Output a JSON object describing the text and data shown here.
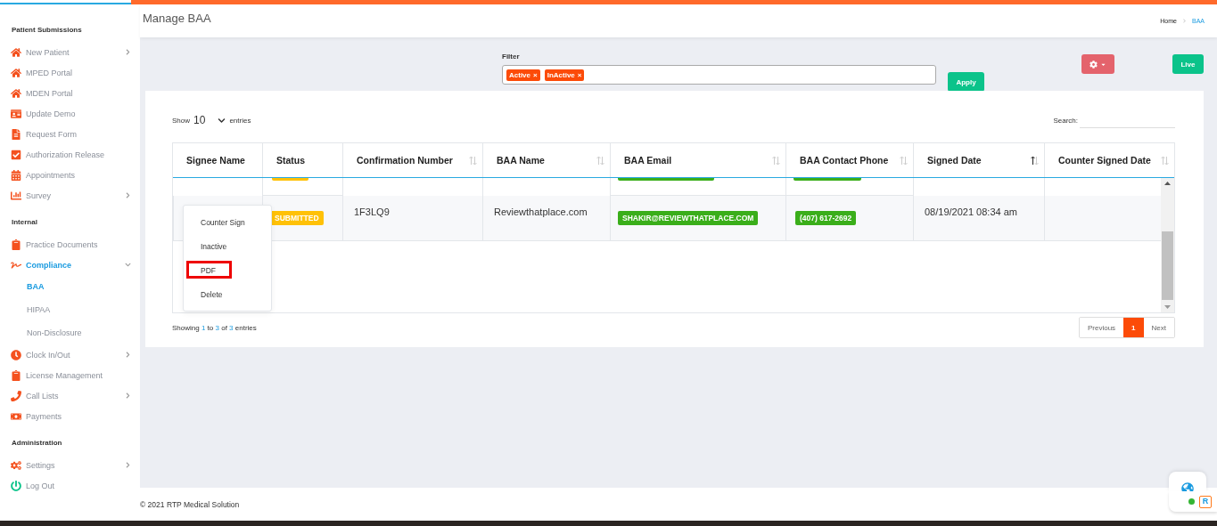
{
  "sidebar": {
    "sections": [
      {
        "title": "Patient Submissions",
        "items": [
          {
            "label": "New Patient",
            "kind": "home",
            "has_submenu": true,
            "expanded": false,
            "selected": false
          },
          {
            "label": "MPED Portal",
            "kind": "home",
            "has_submenu": false,
            "selected": false
          },
          {
            "label": "MDEN Portal",
            "kind": "home",
            "has_submenu": false,
            "selected": false
          },
          {
            "label": "Update Demo",
            "kind": "idcard",
            "has_submenu": false,
            "selected": false
          },
          {
            "label": "Request Form",
            "kind": "file",
            "has_submenu": false,
            "selected": false
          },
          {
            "label": "Authorization Release",
            "kind": "check",
            "has_submenu": false,
            "selected": false
          },
          {
            "label": "Appointments",
            "kind": "calendar",
            "has_submenu": false,
            "selected": false
          },
          {
            "label": "Survey",
            "kind": "chart",
            "has_submenu": true,
            "expanded": false,
            "selected": false
          }
        ]
      },
      {
        "title": "Internal",
        "items": [
          {
            "label": "Practice Documents",
            "kind": "clipboard",
            "has_submenu": false,
            "selected": false
          },
          {
            "label": "Compliance",
            "kind": "signature",
            "has_submenu": true,
            "expanded": true,
            "selected": true,
            "children": [
              {
                "label": "BAA",
                "selected": true
              },
              {
                "label": "HIPAA",
                "selected": false
              },
              {
                "label": "Non-Disclosure",
                "selected": false
              }
            ]
          },
          {
            "label": "Clock In/Out",
            "kind": "clock",
            "has_submenu": true,
            "expanded": false,
            "selected": false
          },
          {
            "label": "License Management",
            "kind": "clipboard",
            "has_submenu": false,
            "selected": false
          },
          {
            "label": "Call Lists",
            "kind": "phone",
            "has_submenu": true,
            "expanded": false,
            "selected": false
          },
          {
            "label": "Payments",
            "kind": "money",
            "has_submenu": false,
            "selected": false
          }
        ]
      },
      {
        "title": "Administration",
        "items": [
          {
            "label": "Settings",
            "kind": "gears",
            "has_submenu": true,
            "expanded": false,
            "selected": false
          },
          {
            "label": "Log Out",
            "kind": "power",
            "has_submenu": false,
            "selected": false
          }
        ]
      }
    ]
  },
  "header": {
    "title": "Manage BAA",
    "breadcrumb": [
      {
        "label": "Home",
        "selected": false
      },
      {
        "label": "BAA",
        "selected": true
      }
    ]
  },
  "filter": {
    "label": "Filter",
    "tags": [
      {
        "label": "Active",
        "remove": "×"
      },
      {
        "label": "InActive",
        "remove": "×"
      }
    ],
    "apply": "Apply",
    "live": "Live"
  },
  "table": {
    "show_label": "Show",
    "page_size": "10",
    "entries_label": "entries",
    "search_label": "Search:",
    "columns": [
      {
        "label": "Signee Name",
        "sortable": false
      },
      {
        "label": "Status",
        "sortable": false
      },
      {
        "label": "Confirmation Number",
        "sortable": true,
        "sorted": false
      },
      {
        "label": "BAA Name",
        "sortable": true,
        "sorted": false
      },
      {
        "label": "BAA Email",
        "sortable": true,
        "sorted": false
      },
      {
        "label": "BAA Contact Phone",
        "sortable": true,
        "sorted": false
      },
      {
        "label": "Signed Date",
        "sortable": true,
        "sorted": true
      },
      {
        "label": "Counter Signed Date",
        "sortable": true,
        "sorted": false
      }
    ],
    "rows": [
      {
        "status": "SUBMITTED",
        "confirmation": "1F3LQ9",
        "baa_name": "Reviewthatplace.com",
        "email": "SHAKIR@REVIEWTHATPLACE.COM",
        "phone": "(407) 617-2692",
        "signed_date": "08/19/2021 08:34 am"
      }
    ],
    "row_menu": [
      {
        "label": "Counter Sign",
        "highlighted": false
      },
      {
        "label": "Inactive",
        "highlighted": false
      },
      {
        "label": "PDF",
        "highlighted": true
      },
      {
        "label": "Delete",
        "highlighted": false
      }
    ],
    "info": "Showing **1** to **3** of **3** entries",
    "pagination": [
      {
        "label": "Previous",
        "selected": false
      },
      {
        "label": "1",
        "selected": true
      },
      {
        "label": "Next",
        "selected": false
      }
    ]
  },
  "footer": "© 2021 RTP Medical Solution",
  "widget": {
    "logo": "R",
    "online": true
  }
}
